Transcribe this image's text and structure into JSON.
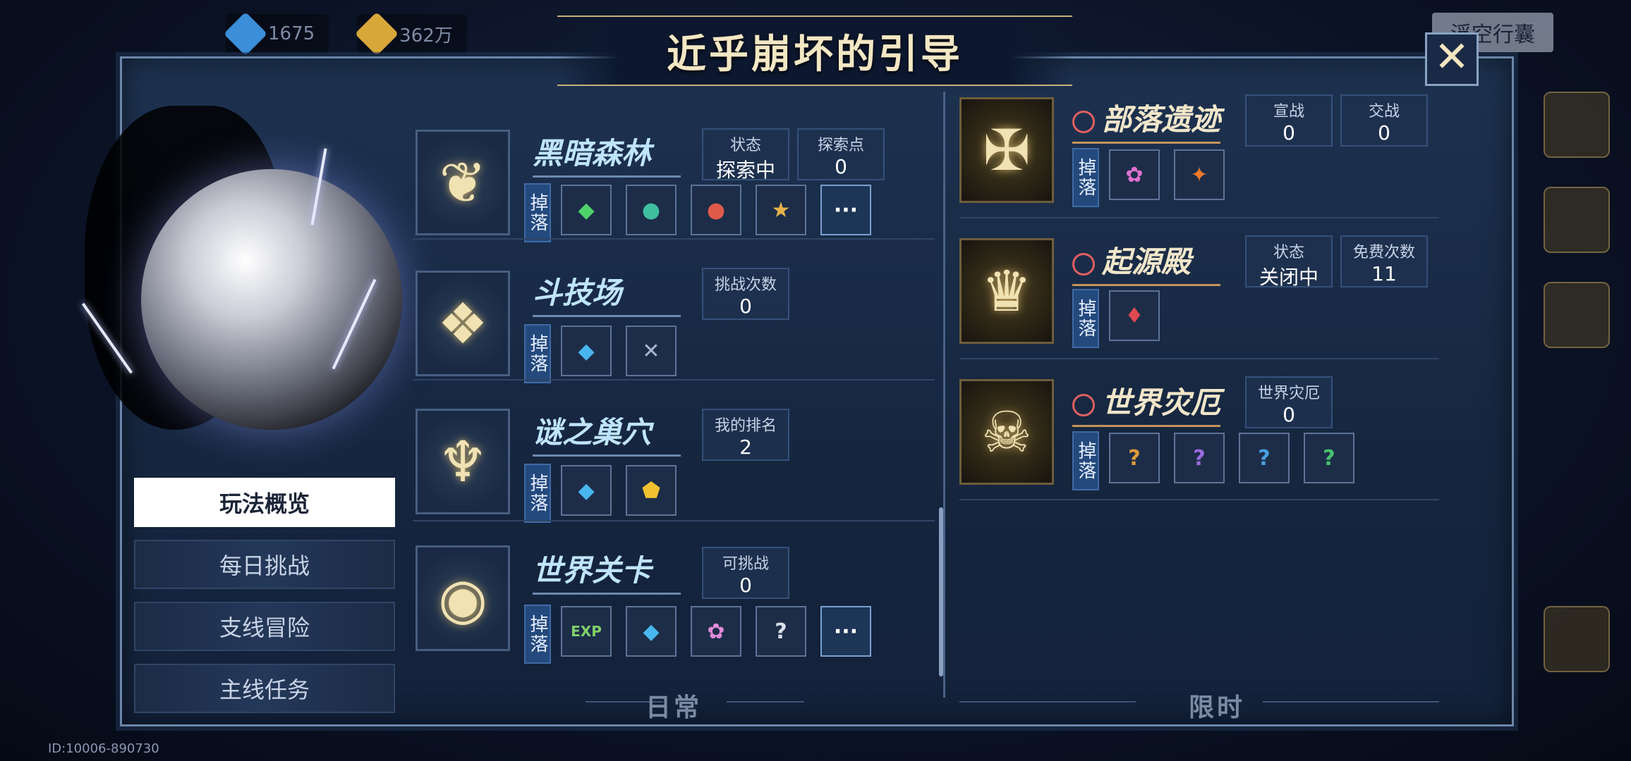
{
  "topbar": {
    "resources": [
      {
        "icon": "blue-gem-icon",
        "value": "1675",
        "color": "#3a8fd8"
      },
      {
        "icon": "gold-gem-icon",
        "value": "362万",
        "color": "#d8a73a"
      }
    ],
    "right_label": "浮空行囊"
  },
  "title": "近乎崩坏的引导",
  "close_icon": "close-icon",
  "left_menu": [
    {
      "label": "玩法概览",
      "active": true
    },
    {
      "label": "每日挑战",
      "active": false
    },
    {
      "label": "支线冒险",
      "active": false
    },
    {
      "label": "主线任务",
      "active": false
    }
  ],
  "daily": {
    "footer": "日常",
    "rows": [
      {
        "name": "黑暗森林",
        "emblem": "dark-forest-emblem",
        "stats": [
          {
            "label": "状态",
            "value": "探索中"
          },
          {
            "label": "探索点",
            "value": "0"
          }
        ],
        "drop_label": "掉落",
        "items": [
          {
            "icon": "green-crystal-icon",
            "color": "#4fd36b"
          },
          {
            "icon": "teal-orb-icon",
            "color": "#3fbfa0"
          },
          {
            "icon": "red-orb-icon",
            "color": "#e05a4a"
          },
          {
            "icon": "gold-star-badge-icon",
            "color": "#e7b24a"
          },
          {
            "icon": "more-icon",
            "text": "···"
          }
        ]
      },
      {
        "name": "斗技场",
        "emblem": "arena-emblem",
        "stats": [
          {
            "label": "挑战次数",
            "value": "0"
          }
        ],
        "drop_label": "掉落",
        "items": [
          {
            "icon": "blue-diamond-icon",
            "color": "#4ab6ef"
          },
          {
            "icon": "crossed-swords-icon",
            "color": "#a9b6d0"
          }
        ]
      },
      {
        "name": "谜之巢穴",
        "emblem": "mystery-lair-emblem",
        "stats": [
          {
            "label": "我的排名",
            "value": "2"
          }
        ],
        "drop_label": "掉落",
        "items": [
          {
            "icon": "blue-diamond-icon",
            "color": "#4ab6ef"
          },
          {
            "icon": "gold-pentagon-icon",
            "color": "#f0c030"
          }
        ]
      },
      {
        "name": "世界关卡",
        "emblem": "world-stage-emblem",
        "stats": [
          {
            "label": "可挑战",
            "value": "0"
          }
        ],
        "drop_label": "掉落",
        "items": [
          {
            "icon": "exp-icon",
            "text": "EXP",
            "color": "#7fd06a"
          },
          {
            "icon": "blue-diamond-icon",
            "color": "#4ab6ef"
          },
          {
            "icon": "pink-flower-icon",
            "color": "#e08ad8"
          },
          {
            "icon": "unknown-item-icon",
            "text": "?",
            "color": "#d8dde8"
          },
          {
            "icon": "more-icon",
            "text": "···"
          }
        ]
      }
    ]
  },
  "limited": {
    "footer": "限时",
    "rows": [
      {
        "name": "部落遗迹",
        "emblem": "tribal-ruins-emblem",
        "stats": [
          {
            "label": "宣战",
            "value": "0"
          },
          {
            "label": "交战",
            "value": "0"
          }
        ],
        "drop_label": "掉落",
        "items": [
          {
            "icon": "pink-rose-icon",
            "color": "#e070d0"
          },
          {
            "icon": "fire-wing-icon",
            "color": "#ef7a2a"
          }
        ]
      },
      {
        "name": "起源殿",
        "emblem": "origin-temple-emblem",
        "stats": [
          {
            "label": "状态",
            "value": "关闭中"
          },
          {
            "label": "免费次数",
            "value": "11"
          }
        ],
        "drop_label": "掉落",
        "items": [
          {
            "icon": "red-crystal-icon",
            "color": "#e04a50"
          }
        ]
      },
      {
        "name": "世界灾厄",
        "emblem": "world-calamity-emblem",
        "stats": [
          {
            "label": "世界灾厄",
            "value": "0"
          }
        ],
        "drop_label": "掉落",
        "items": [
          {
            "icon": "orange-unknown-icon",
            "text": "?",
            "color": "#e09a3a"
          },
          {
            "icon": "purple-unknown-icon",
            "text": "?",
            "color": "#9a6ae0"
          },
          {
            "icon": "blue-unknown-icon",
            "text": "?",
            "color": "#4aa0e0"
          },
          {
            "icon": "green-unknown-icon",
            "text": "?",
            "color": "#4ac070"
          }
        ]
      }
    ]
  },
  "game_id": "ID:10006-890730"
}
